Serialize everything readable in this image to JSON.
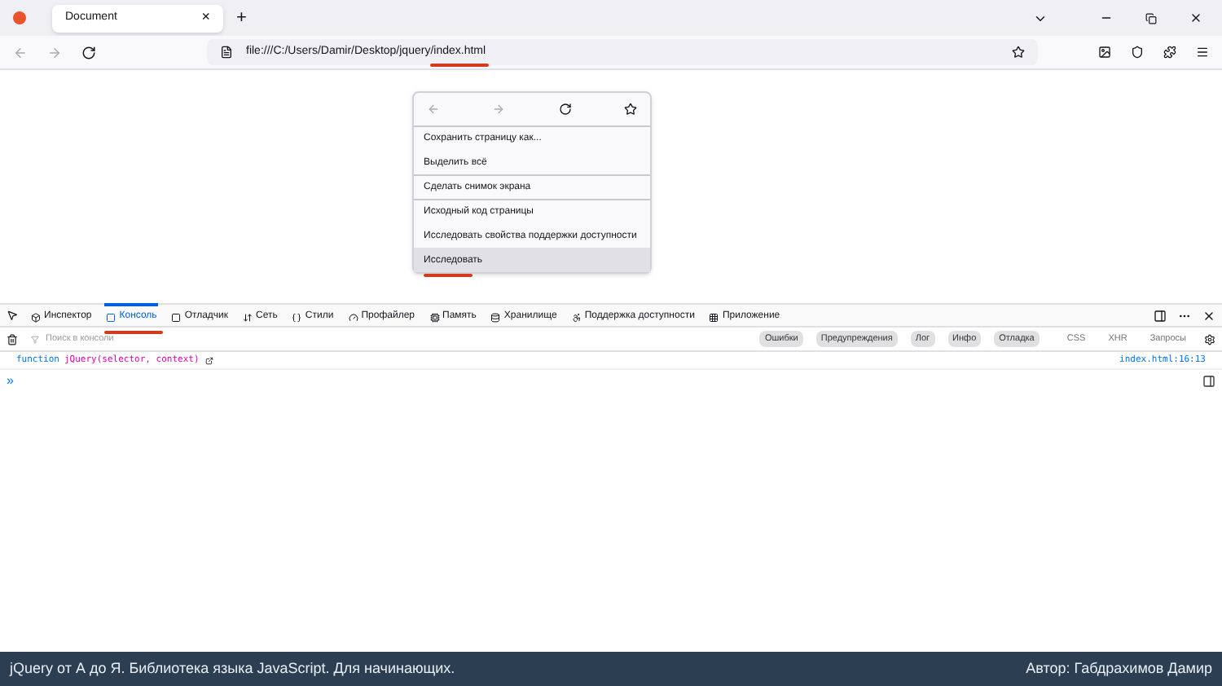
{
  "browser": {
    "tab_title": "Document",
    "tab_close": "×",
    "new_tab": "+",
    "url": "file:///C:/Users/Damir/Desktop/jquery/index.html"
  },
  "context_menu": {
    "items": [
      {
        "label": "Сохранить страницу как...",
        "separator_before": true,
        "selected": false
      },
      {
        "label": "Выделить всё",
        "separator_before": false,
        "selected": false
      },
      {
        "label": "Сделать снимок экрана",
        "separator_before": true,
        "selected": false
      },
      {
        "label": "Исходный код страницы",
        "separator_before": true,
        "selected": false
      },
      {
        "label": "Исследовать свойства поддержки доступности",
        "separator_before": false,
        "selected": false
      },
      {
        "label": "Исследовать",
        "separator_before": false,
        "selected": true
      }
    ]
  },
  "devtools": {
    "tabs": [
      {
        "label": "Инспектор",
        "selected": false
      },
      {
        "label": "Консоль",
        "selected": true
      },
      {
        "label": "Отладчик",
        "selected": false
      },
      {
        "label": "Сеть",
        "selected": false
      },
      {
        "label": "Стили",
        "selected": false
      },
      {
        "label": "Профайлер",
        "selected": false
      },
      {
        "label": "Память",
        "selected": false
      },
      {
        "label": "Хранилище",
        "selected": false
      },
      {
        "label": "Поддержка доступности",
        "selected": false
      },
      {
        "label": "Приложение",
        "selected": false
      }
    ],
    "filter": {
      "placeholder": "Поиск в консоли"
    },
    "levels": [
      {
        "label": "Ошибки",
        "selected": true
      },
      {
        "label": "Предупреждения",
        "selected": true
      },
      {
        "label": "Лог",
        "selected": true
      },
      {
        "label": "Инфо",
        "selected": true
      },
      {
        "label": "Отладка",
        "selected": true
      },
      {
        "label": "CSS",
        "selected": false
      },
      {
        "label": "XHR",
        "selected": false
      },
      {
        "label": "Запросы",
        "selected": false
      }
    ],
    "output": [
      {
        "keyword": "function",
        "name": "jQuery",
        "params": "(selector, context)",
        "source": "index.html:16:13"
      }
    ],
    "prompt": "»"
  },
  "footer": {
    "left": "jQuery от А до Я. Библиотека языка JavaScript. Для начинающих.",
    "right": "Автор: Габдрахимов Дамир"
  }
}
